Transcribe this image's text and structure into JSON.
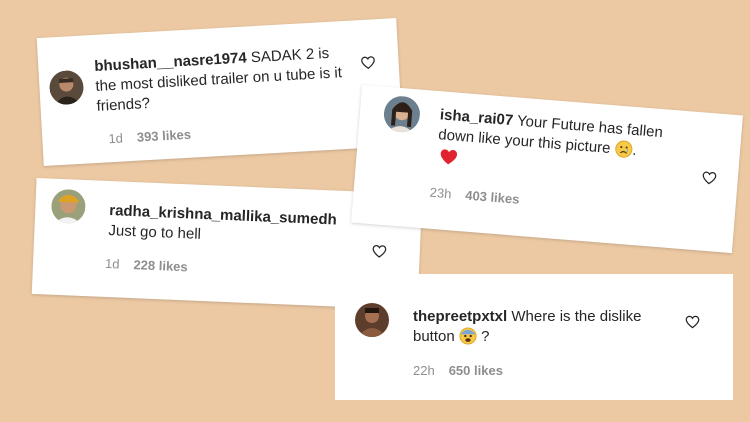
{
  "theme": {
    "background": "#ecc9a3",
    "card": "#ffffff",
    "text": "#262626",
    "muted": "#8e8e8e",
    "heart_red": "#e0242f"
  },
  "comments": [
    {
      "username": "bhushan__nasre1974",
      "text": "SADAK 2 is the most disliked trailer on u tube is it friends?",
      "time": "1d",
      "likes": "393 likes",
      "icon": "heart-outline-icon"
    },
    {
      "username": "isha_rai07",
      "text": "Your Future has fallen down like your this picture",
      "text_end": ".",
      "time": "23h",
      "likes": "403 likes",
      "icon": "heart-outline-icon",
      "emojis": [
        "red-heart-emoji",
        "sad-face-emoji"
      ]
    },
    {
      "username": "radha_krishna_mallika_sumedh",
      "text": "Just go to hell",
      "time": "1d",
      "likes": "228 likes",
      "icon": "heart-outline-icon"
    },
    {
      "username": "thepreetpxtxl",
      "text": "Where is the dislike button",
      "text_end": "?",
      "time": "22h",
      "likes": "650 likes",
      "icon": "heart-outline-icon",
      "emojis": [
        "fearful-face-emoji"
      ]
    }
  ]
}
